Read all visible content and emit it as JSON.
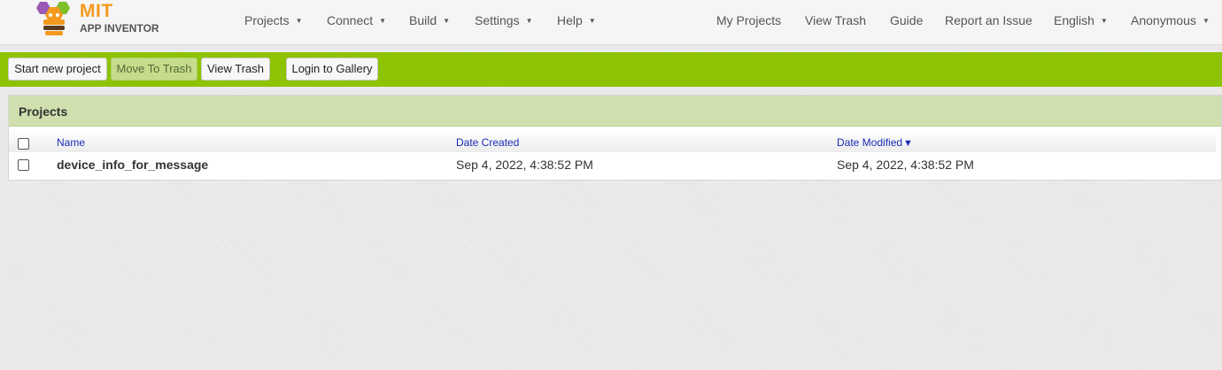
{
  "brand": {
    "line1": "MIT",
    "line2": "APP INVENTOR"
  },
  "nav_left": [
    {
      "label": "Projects",
      "caret": "▼"
    },
    {
      "label": "Connect",
      "caret": "▼"
    },
    {
      "label": "Build",
      "caret": "▼"
    },
    {
      "label": "Settings",
      "caret": "▼"
    },
    {
      "label": "Help",
      "caret": "▼"
    }
  ],
  "nav_right": [
    {
      "label": "My Projects"
    },
    {
      "label": "View Trash"
    },
    {
      "label": "Guide"
    },
    {
      "label": "Report an Issue"
    },
    {
      "label": "English",
      "caret": "▼"
    },
    {
      "label": "Anonymous",
      "caret": "▼"
    }
  ],
  "toolbar": {
    "start_new": "Start new project",
    "move_to_trash": "Move To Trash",
    "view_trash": "View Trash",
    "login_gallery": "Login to Gallery"
  },
  "projects": {
    "title": "Projects",
    "columns": {
      "name": "Name",
      "date_created": "Date Created",
      "date_modified": "Date Modified",
      "sort_indicator": "▼"
    },
    "rows": [
      {
        "name": "device_info_for_message",
        "date_created": "Sep 4, 2022, 4:38:52 PM",
        "date_modified": "Sep 4, 2022, 4:38:52 PM"
      }
    ]
  },
  "colors": {
    "toolbar_green": "#8dc300",
    "panel_header": "#cfdfae",
    "link_blue": "#1a2bb5",
    "logo_orange": "#f39a1e"
  }
}
